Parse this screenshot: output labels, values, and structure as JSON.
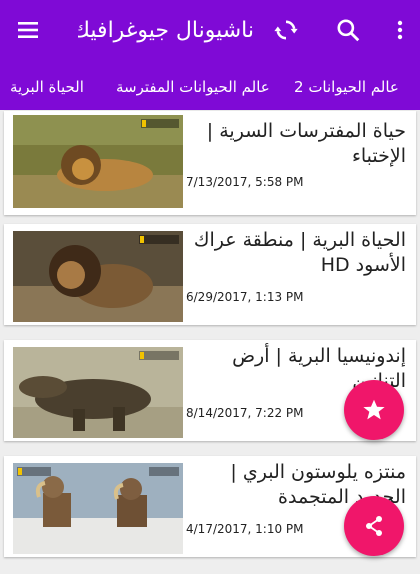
{
  "toolbar": {
    "title": "ناشيونال جيوغرافيك",
    "icons": [
      "menu-icon",
      "refresh-icon",
      "search-icon",
      "more-vert-icon"
    ]
  },
  "tabs": [
    {
      "label": "الحياة البرية",
      "active": true
    },
    {
      "label": "عالم الحيوانات المفترسة",
      "active": false
    },
    {
      "label": "عالم الحيوانات 2",
      "active": false
    }
  ],
  "thumb_badge": "ناشيونال جيوغرافيك",
  "videos": [
    {
      "title": "حياة المفترسات السرية | الإختباء",
      "date": "7/13/2017, 5:58 PM"
    },
    {
      "title": "الحياة البرية | منطقة عراك الأسود HD",
      "date": "6/29/2017, 1:13 PM"
    },
    {
      "title": "إندونيسيا البرية | أرض التنانين",
      "date": "8/14/2017, 7:22 PM"
    },
    {
      "title": "منتزه يلوستون البري | الحدود المتجمدة",
      "date": "4/17/2017, 1:10 PM"
    }
  ],
  "fabs": [
    "star-icon",
    "share-icon"
  ],
  "colors": {
    "primary": "#7f0ad6",
    "accent": "#f0166a"
  }
}
